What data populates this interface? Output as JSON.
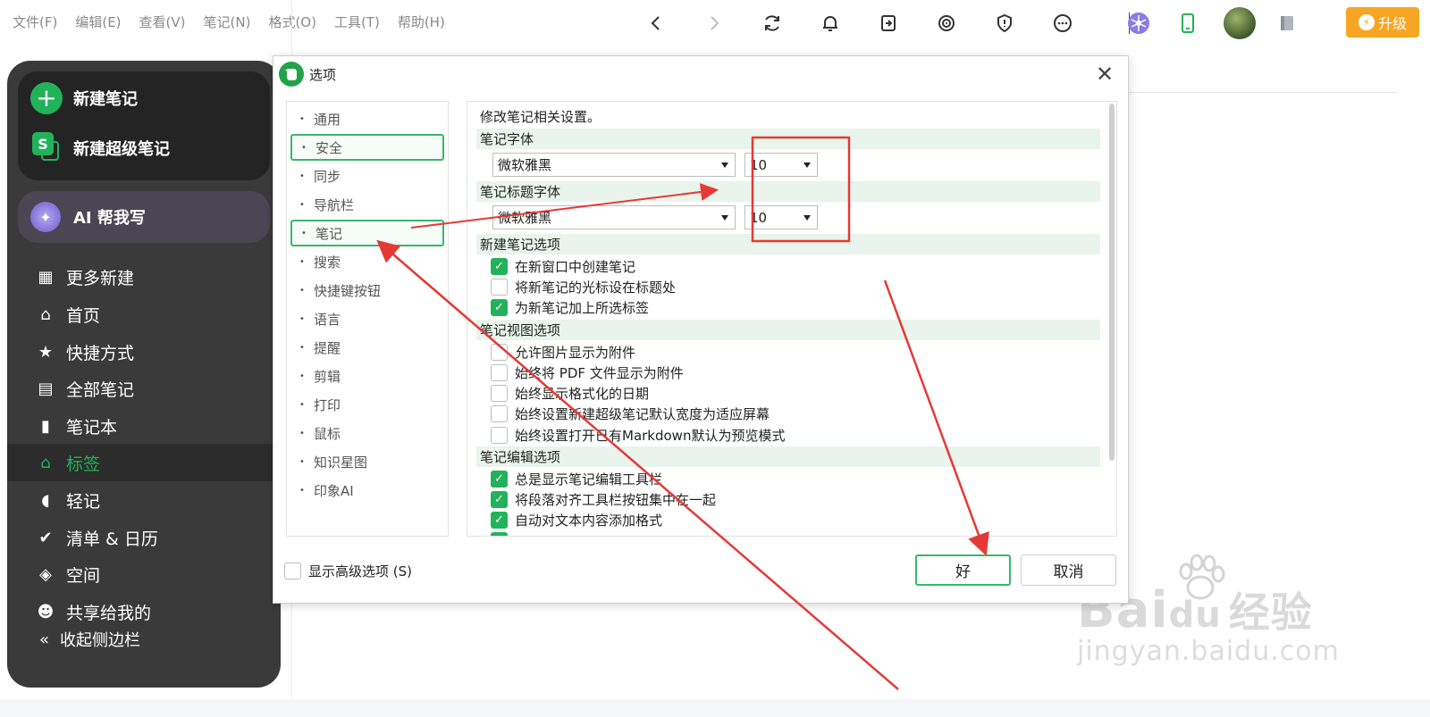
{
  "menu": [
    "文件(F)",
    "编辑(E)",
    "查看(V)",
    "笔记(N)",
    "格式(O)",
    "工具(T)",
    "帮助(H)"
  ],
  "toolbar": {
    "icons": [
      "back-icon",
      "forward-icon",
      "sync-icon",
      "bell-icon",
      "share-icon",
      "target-icon",
      "shield-icon",
      "more-icon",
      "network-icon",
      "phone-icon",
      "avatar",
      "notebook-icon"
    ],
    "upgrade_label": "升级"
  },
  "sidebar": {
    "new_note": "新建笔记",
    "new_super_note": "新建超级笔记",
    "ai_write": "AI 帮我写",
    "items": [
      {
        "label": "更多新建",
        "icon": "grid-icon"
      },
      {
        "label": "首页",
        "icon": "home-icon"
      },
      {
        "label": "快捷方式",
        "icon": "star-icon"
      },
      {
        "label": "全部笔记",
        "icon": "note-icon"
      },
      {
        "label": "笔记本",
        "icon": "notebook-icon"
      },
      {
        "label": "标签",
        "icon": "tag-icon",
        "active": true
      },
      {
        "label": "轻记",
        "icon": "quick-note-icon"
      },
      {
        "label": "清单 & 日历",
        "icon": "checklist-icon"
      },
      {
        "label": "空间",
        "icon": "space-icon"
      },
      {
        "label": "共享给我的",
        "icon": "shared-icon"
      }
    ],
    "collapse": "收起侧边栏"
  },
  "dialog": {
    "title": "选项",
    "nav": [
      "通用",
      "安全",
      "同步",
      "导航栏",
      "笔记",
      "搜索",
      "快捷键按钮",
      "语言",
      "提醒",
      "剪辑",
      "打印",
      "鼠标",
      "知识星图",
      "印象AI"
    ],
    "nav_selected": [
      "安全",
      "笔记"
    ],
    "intro": "修改笔记相关设置。",
    "font_section": "笔记字体",
    "font_family": "微软雅黑",
    "font_size": "10",
    "title_font_section": "笔记标题字体",
    "title_font_family": "微软雅黑",
    "title_font_size": "10",
    "new_note_section": "新建笔记选项",
    "new_note_options": [
      {
        "label": "在新窗口中创建笔记",
        "checked": true
      },
      {
        "label": "将新笔记的光标设在标题处",
        "checked": false
      },
      {
        "label": "为新笔记加上所选标签",
        "checked": true
      }
    ],
    "view_section": "笔记视图选项",
    "view_options": [
      {
        "label": "允许图片显示为附件",
        "checked": false
      },
      {
        "label": "始终将 PDF 文件显示为附件",
        "checked": false
      },
      {
        "label": "始终显示格式化的日期",
        "checked": false
      },
      {
        "label": "始终设置新建超级笔记默认宽度为适应屏幕",
        "checked": false
      },
      {
        "label": "始终设置打开已有Markdown默认为预览模式",
        "checked": false
      }
    ],
    "edit_section": "笔记编辑选项",
    "edit_options": [
      {
        "label": "总是显示笔记编辑工具栏",
        "checked": true
      },
      {
        "label": "将段落对齐工具栏按钮集中在一起",
        "checked": true
      },
      {
        "label": "自动对文本内容添加格式",
        "checked": true
      }
    ],
    "advanced_label": "显示高级选项 (S)",
    "ok_label": "好",
    "cancel_label": "取消"
  },
  "watermark": {
    "brand": "Bai",
    "brand_suffix": "du",
    "cn": "经验",
    "url": "jingyan.baidu.com"
  },
  "colors": {
    "accent": "#22b35a",
    "upgrade": "#f6a623",
    "annotation": "#e53935"
  }
}
